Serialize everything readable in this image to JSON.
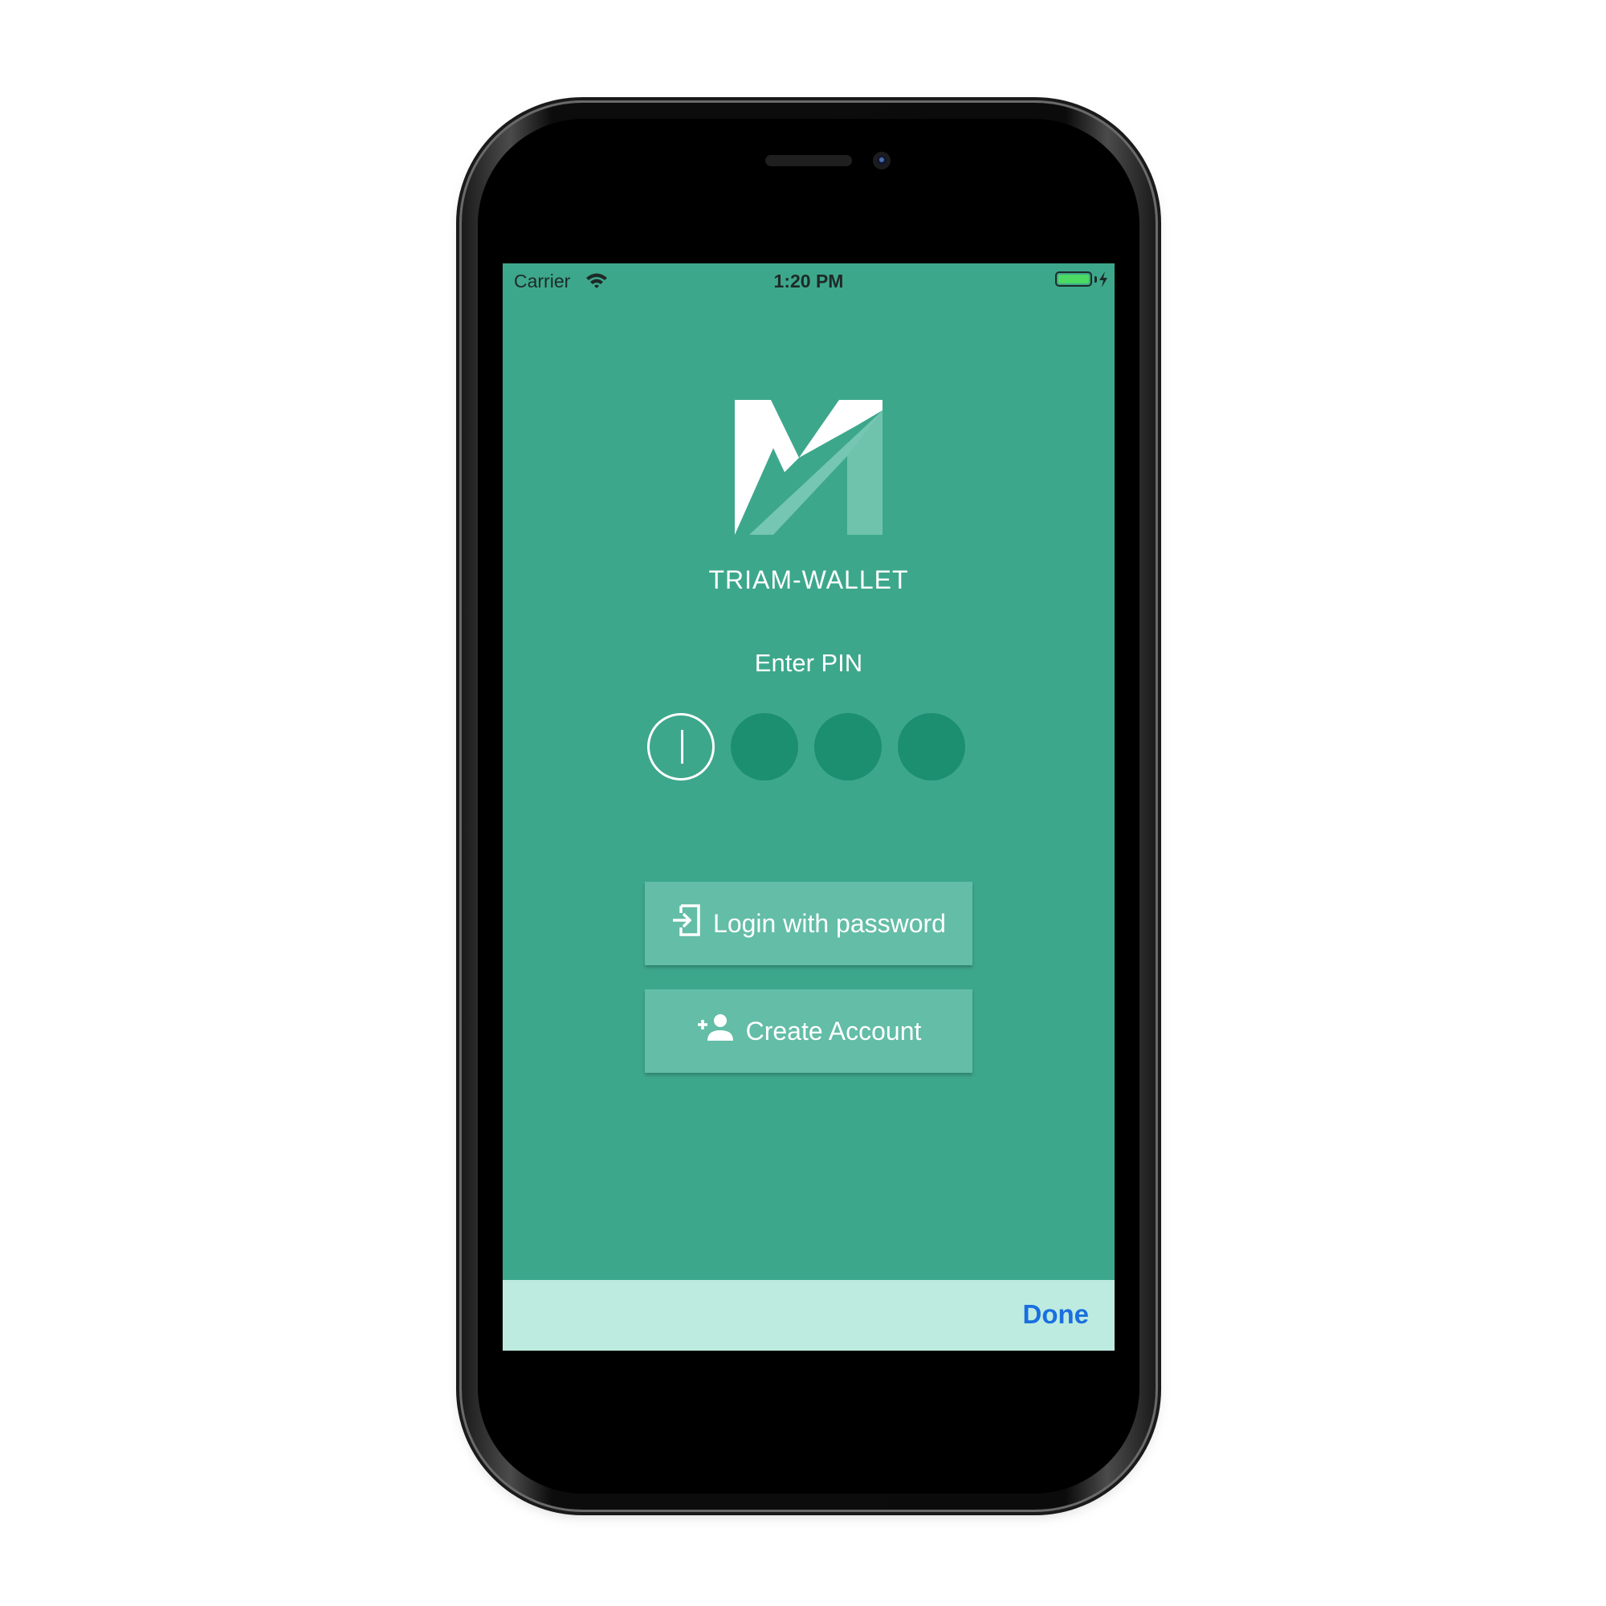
{
  "status_bar": {
    "carrier": "Carrier",
    "time": "1:20 PM",
    "wifi_icon": "wifi-icon",
    "battery_icon": "battery-charging-icon"
  },
  "app": {
    "logo_icon": "triam-logo",
    "brand_name": "TRIAM-WALLET",
    "pin_prompt": "Enter PIN",
    "pin_length": 4,
    "pin_filled": 0
  },
  "actions": {
    "login_with_password": {
      "label": "Login with password",
      "icon": "login-icon"
    },
    "create_account": {
      "label": "Create Account",
      "icon": "add-person-icon"
    }
  },
  "keyboard_toolbar": {
    "done_label": "Done"
  },
  "colors": {
    "background": "#3da78c",
    "pin_empty": "#1c8f71",
    "button": "#63bda7",
    "toolbar": "#bdebdf",
    "done_link": "#1a6fe0"
  }
}
